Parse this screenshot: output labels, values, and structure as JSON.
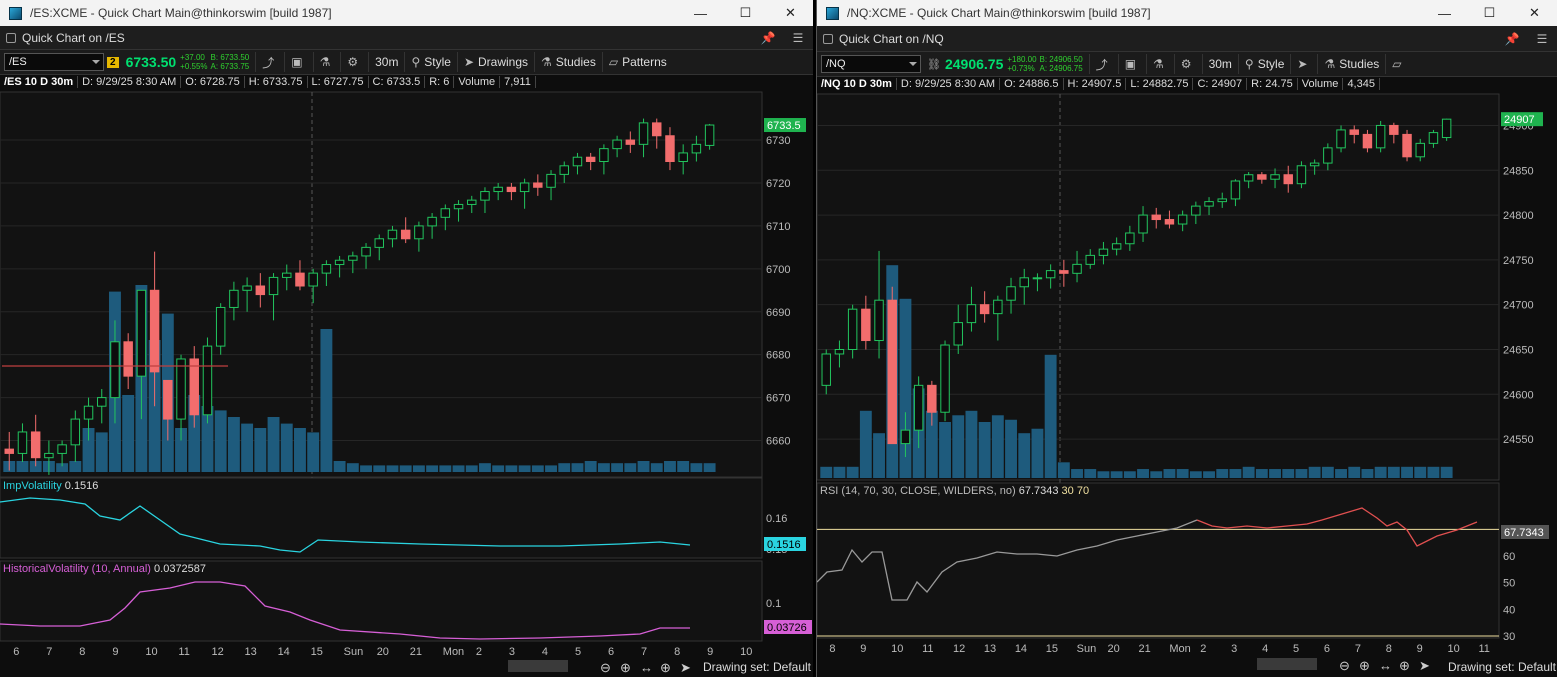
{
  "left": {
    "title": "/ES:XCME - Quick Chart Main@thinkorswim [build 1987]",
    "header": "Quick Chart on /ES",
    "symbol": "/ES",
    "link_badge": "2",
    "last": "6733.50",
    "change": "+37.00",
    "change_pct": "+0.55%",
    "bid": "B: 6733.50",
    "ask": "A: 6733.75",
    "aggregation": "30m",
    "tools": {
      "style": "Style",
      "drawings": "Drawings",
      "studies": "Studies",
      "patterns": "Patterns"
    },
    "info": {
      "symbol_period": "/ES 10 D 30m",
      "date": "D: 9/29/25 8:30 AM",
      "open": "O: 6728.75",
      "high": "H: 6733.75",
      "low": "L: 6727.75",
      "close": "C: 6733.5",
      "range": "R: 6",
      "volume_label": "Volume",
      "volume": "7,911"
    },
    "price_label": "6733.5",
    "y_ticks": [
      "6730",
      "6720",
      "6710",
      "6700",
      "6690",
      "6680",
      "6670",
      "6660"
    ],
    "x_ticks": [
      "6",
      "7",
      "8",
      "9",
      "10",
      "11",
      "12",
      "13",
      "14",
      "15",
      "Sun",
      "20",
      "21",
      "Mon",
      "2",
      "3",
      "4",
      "5",
      "6",
      "7",
      "8",
      "9",
      "10"
    ],
    "study1": {
      "label": "ImpVolatility",
      "value": "0.1516",
      "ticks": [
        "0.16",
        "0.15"
      ],
      "badge": "0.1516"
    },
    "study2": {
      "label": "HistoricalVolatility (10, Annual)",
      "value": "0.0372587",
      "ticks": [
        "0.1"
      ],
      "badge": "0.03726"
    },
    "status": "Drawing set: Default"
  },
  "right": {
    "title": "/NQ:XCME - Quick Chart Main@thinkorswim [build 1987]",
    "header": "Quick Chart on /NQ",
    "symbol": "/NQ",
    "last": "24906.75",
    "change": "+180.00",
    "change_pct": "+0.73%",
    "bid": "B: 24906.50",
    "ask": "A: 24906.75",
    "aggregation": "30m",
    "tools": {
      "style": "Style",
      "studies": "Studies"
    },
    "info": {
      "symbol_period": "/NQ 10 D 30m",
      "date": "D: 9/29/25 8:30 AM",
      "open": "O: 24886.5",
      "high": "H: 24907.5",
      "low": "L: 24882.75",
      "close": "C: 24907",
      "range": "R: 24.75",
      "volume_label": "Volume",
      "volume": "4,345"
    },
    "price_label": "24907",
    "y_ticks": [
      "24900",
      "24850",
      "24800",
      "24750",
      "24700",
      "24650",
      "24600",
      "24550"
    ],
    "x_ticks": [
      "8",
      "9",
      "10",
      "11",
      "12",
      "13",
      "14",
      "15",
      "Sun",
      "20",
      "21",
      "Mon",
      "2",
      "3",
      "4",
      "5",
      "6",
      "7",
      "8",
      "9",
      "10",
      "11"
    ],
    "rsi": {
      "label": "RSI (14, 70, 30, CLOSE, WILDERS, no)",
      "value": "67.7343",
      "ob": "30",
      "os": "70",
      "ticks": [
        "60",
        "50",
        "40",
        "30"
      ],
      "badge": "67.7343"
    },
    "status": "Drawing set: Default"
  },
  "colors": {
    "up": "#22c55e",
    "down": "#f26d6d",
    "volume": "#1e5b7d",
    "iv": "#2ad4e0",
    "hv": "#d65fd6",
    "rsi": "#9a9a9a",
    "rsi_hi": "#e05050",
    "ref": "#f0e0a0"
  },
  "chart_data": [
    {
      "type": "candlestick",
      "symbol": "/ES",
      "period": "10 D 30m",
      "ylim": [
        6655,
        6737
      ],
      "candles": [
        [
          6658,
          6662,
          6653,
          6657
        ],
        [
          6657,
          6664,
          6655,
          6662
        ],
        [
          6662,
          6666,
          6654,
          6656
        ],
        [
          6656,
          6660,
          6652,
          6657
        ],
        [
          6657,
          6660,
          6654,
          6659
        ],
        [
          6659,
          6667,
          6655,
          6665
        ],
        [
          6665,
          6670,
          6660,
          6668
        ],
        [
          6668,
          6672,
          6664,
          6670
        ],
        [
          6670,
          6688,
          6664,
          6683
        ],
        [
          6683,
          6685,
          6672,
          6675
        ],
        [
          6675,
          6695,
          6665,
          6695
        ],
        [
          6695,
          6704,
          6668,
          6676
        ],
        [
          6674,
          6672,
          6660,
          6665
        ],
        [
          6665,
          6680,
          6660,
          6679
        ],
        [
          6679,
          6682,
          6663,
          6666
        ],
        [
          6666,
          6684,
          6664,
          6682
        ],
        [
          6682,
          6692,
          6680,
          6691
        ],
        [
          6691,
          6697,
          6688,
          6695
        ],
        [
          6695,
          6698,
          6690,
          6696
        ],
        [
          6696,
          6699,
          6691,
          6694
        ],
        [
          6694,
          6699,
          6688,
          6698
        ],
        [
          6698,
          6701,
          6695,
          6699
        ],
        [
          6699,
          6702,
          6695,
          6696
        ],
        [
          6696,
          6700,
          6692,
          6699
        ],
        [
          6699,
          6702,
          6696,
          6701
        ],
        [
          6701,
          6703,
          6698,
          6702
        ],
        [
          6702,
          6704,
          6699,
          6703
        ],
        [
          6703,
          6706,
          6700,
          6705
        ],
        [
          6705,
          6708,
          6702,
          6707
        ],
        [
          6707,
          6710,
          6705,
          6709
        ],
        [
          6709,
          6712,
          6706,
          6707
        ],
        [
          6707,
          6711,
          6704,
          6710
        ],
        [
          6710,
          6713,
          6707,
          6712
        ],
        [
          6712,
          6715,
          6709,
          6714
        ],
        [
          6714,
          6716,
          6711,
          6715
        ],
        [
          6715,
          6717,
          6713,
          6716
        ],
        [
          6716,
          6719,
          6713,
          6718
        ],
        [
          6718,
          6720,
          6716,
          6719
        ],
        [
          6719,
          6720,
          6716,
          6718
        ],
        [
          6718,
          6721,
          6714,
          6720
        ],
        [
          6720,
          6722,
          6717,
          6719
        ],
        [
          6719,
          6723,
          6716,
          6722
        ],
        [
          6722,
          6725,
          6720,
          6724
        ],
        [
          6724,
          6727,
          6722,
          6726
        ],
        [
          6726,
          6727,
          6723,
          6725
        ],
        [
          6725,
          6729,
          6722,
          6728
        ],
        [
          6728,
          6731,
          6726,
          6730
        ],
        [
          6730,
          6732,
          6727,
          6729
        ],
        [
          6729,
          6735,
          6726,
          6734
        ],
        [
          6734,
          6735,
          6728,
          6731
        ],
        [
          6731,
          6733,
          6723,
          6725
        ],
        [
          6725,
          6729,
          6722,
          6727
        ],
        [
          6727,
          6731,
          6725,
          6729
        ],
        [
          6728.75,
          6733.75,
          6727.75,
          6733.5
        ]
      ],
      "study_imp_volatility_last": 0.1516,
      "study_historical_volatility_last": 0.0372587
    },
    {
      "type": "candlestick",
      "symbol": "/NQ",
      "period": "10 D 30m",
      "ylim": [
        24520,
        24915
      ],
      "candles": [
        [
          24610,
          24650,
          24600,
          24645
        ],
        [
          24645,
          24660,
          24630,
          24650
        ],
        [
          24650,
          24700,
          24640,
          24695
        ],
        [
          24695,
          24710,
          24650,
          24660
        ],
        [
          24660,
          24760,
          24640,
          24705
        ],
        [
          24705,
          24720,
          24550,
          24545
        ],
        [
          24545,
          24580,
          24530,
          24560
        ],
        [
          24560,
          24620,
          24540,
          24610
        ],
        [
          24610,
          24615,
          24565,
          24580
        ],
        [
          24580,
          24660,
          24570,
          24655
        ],
        [
          24655,
          24700,
          24645,
          24680
        ],
        [
          24680,
          24720,
          24670,
          24700
        ],
        [
          24700,
          24715,
          24680,
          24690
        ],
        [
          24690,
          24710,
          24660,
          24705
        ],
        [
          24705,
          24730,
          24690,
          24720
        ],
        [
          24720,
          24740,
          24700,
          24730
        ],
        [
          24730,
          24735,
          24715,
          24730
        ],
        [
          24730,
          24745,
          24718,
          24738
        ],
        [
          24738,
          24750,
          24720,
          24735
        ],
        [
          24735,
          24760,
          24725,
          24745
        ],
        [
          24745,
          24762,
          24740,
          24755
        ],
        [
          24755,
          24770,
          24745,
          24762
        ],
        [
          24762,
          24775,
          24755,
          24768
        ],
        [
          24768,
          24788,
          24760,
          24780
        ],
        [
          24780,
          24810,
          24770,
          24800
        ],
        [
          24800,
          24808,
          24785,
          24795
        ],
        [
          24795,
          24805,
          24785,
          24790
        ],
        [
          24790,
          24805,
          24782,
          24800
        ],
        [
          24800,
          24815,
          24790,
          24810
        ],
        [
          24810,
          24820,
          24800,
          24815
        ],
        [
          24815,
          24825,
          24808,
          24818
        ],
        [
          24818,
          24840,
          24810,
          24838
        ],
        [
          24838,
          24848,
          24830,
          24845
        ],
        [
          24845,
          24848,
          24835,
          24840
        ],
        [
          24840,
          24852,
          24830,
          24845
        ],
        [
          24845,
          24855,
          24825,
          24835
        ],
        [
          24835,
          24860,
          24830,
          24855
        ],
        [
          24855,
          24862,
          24845,
          24858
        ],
        [
          24858,
          24880,
          24850,
          24875
        ],
        [
          24875,
          24900,
          24870,
          24895
        ],
        [
          24895,
          24900,
          24880,
          24890
        ],
        [
          24890,
          24895,
          24870,
          24875
        ],
        [
          24875,
          24905,
          24870,
          24900
        ],
        [
          24900,
          24903,
          24880,
          24890
        ],
        [
          24890,
          24895,
          24860,
          24865
        ],
        [
          24865,
          24885,
          24860,
          24880
        ],
        [
          24880,
          24895,
          24875,
          24892
        ],
        [
          24886.5,
          24907.5,
          24882.75,
          24907
        ]
      ],
      "rsi_last": 67.7343,
      "rsi_overbought": 70,
      "rsi_oversold": 30
    }
  ]
}
